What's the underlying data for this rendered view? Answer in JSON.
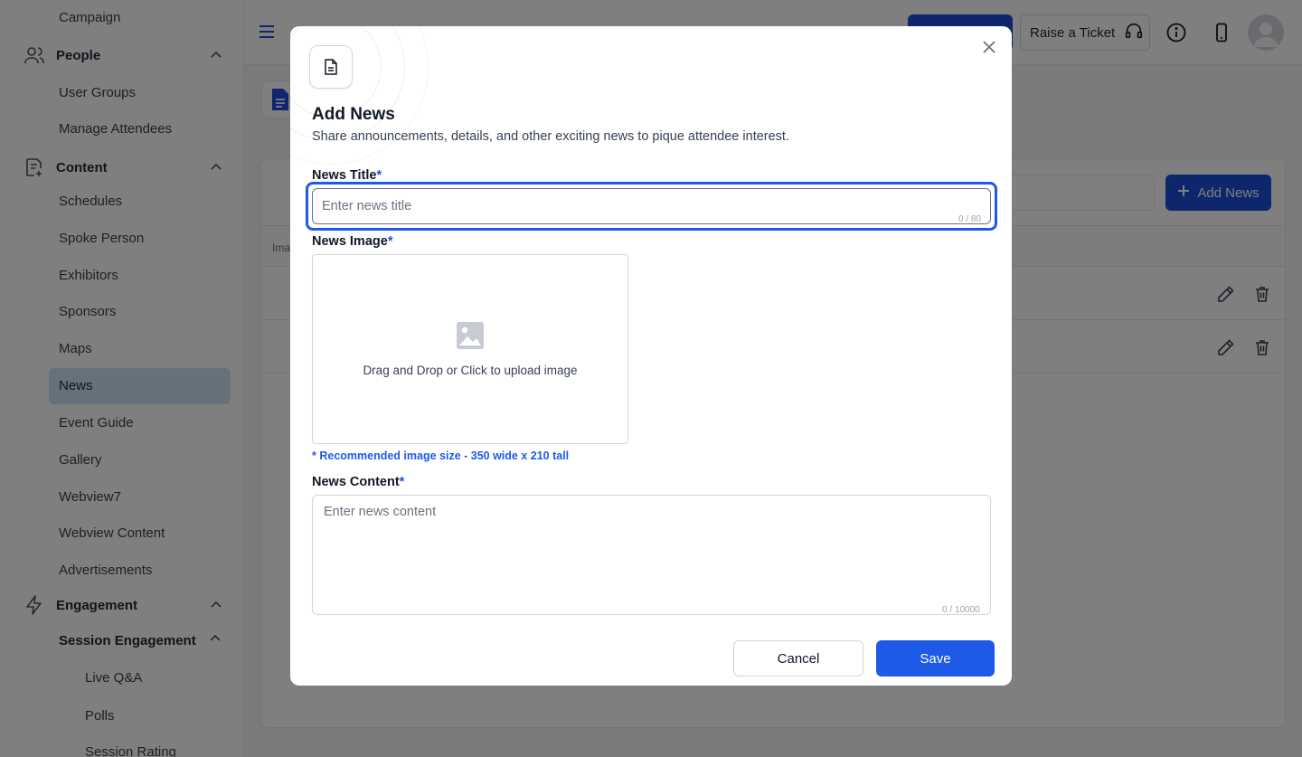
{
  "sidebar": {
    "campaign": "Campaign",
    "people": {
      "label": "People",
      "items": [
        "User Groups",
        "Manage Attendees"
      ]
    },
    "content": {
      "label": "Content",
      "items": [
        "Schedules",
        "Spoke Person",
        "Exhibitors",
        "Sponsors",
        "Maps",
        "News",
        "Event Guide",
        "Gallery",
        "Webview7",
        "Webview Content",
        "Advertisements"
      ],
      "active": "News"
    },
    "engagement": {
      "label": "Engagement",
      "session_engagement": {
        "label": "Session Engagement",
        "items": [
          "Live Q&A",
          "Polls",
          "Session Rating"
        ]
      }
    }
  },
  "topbar": {
    "raise_ticket": "Raise a Ticket",
    "icons": [
      "menu-icon",
      "headset-icon",
      "info-icon",
      "mobile-icon",
      "user-avatar-icon"
    ]
  },
  "main": {
    "add_news_label": "Add News",
    "table_header_partial": "Ima"
  },
  "modal": {
    "title": "Add News",
    "subtitle": "Share announcements, details, and other exciting news to pique attendee interest.",
    "news_title": {
      "label": "News Title",
      "required_mark": "*",
      "placeholder": "Enter news title",
      "value": "",
      "counter": "0 / 80"
    },
    "news_image": {
      "label": "News Image",
      "required_mark": "*",
      "upload_text": "Drag and Drop or Click to upload image",
      "recommendation": "* Recommended image size - 350 wide x 210 tall"
    },
    "news_content": {
      "label": "News Content",
      "required_mark": "*",
      "placeholder": "Enter news content",
      "value": "",
      "counter": "0 / 10000"
    },
    "cancel_label": "Cancel",
    "save_label": "Save"
  },
  "colors": {
    "primary": "#1d5ae8",
    "sidebar_active": "#cfe3f7",
    "overlay": "rgba(0,0,0,0.5)"
  }
}
